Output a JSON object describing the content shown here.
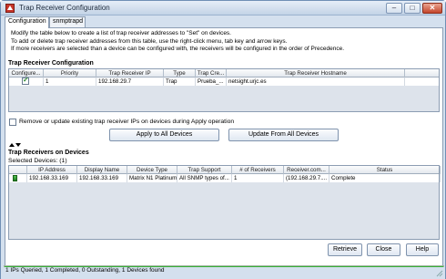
{
  "window": {
    "title": "Trap Receiver Configuration",
    "minimize": "–",
    "maximize": "□",
    "close": "✕"
  },
  "tabs": [
    {
      "label": "Configuration",
      "active": true
    },
    {
      "label": "snmptrapd",
      "active": false
    }
  ],
  "info_lines": [
    "Modify the table below to create a list of trap receiver addresses to \"Set\" on devices.",
    "To add or delete trap receiver addresses from this table, use the right-click menu, tab key and arrow keys.",
    "If more receivers are selected than a device can be configured with, the receivers will be configured in the order of Precedence."
  ],
  "config_section": {
    "title": "Trap Receiver Configuration",
    "columns": [
      "Configure...",
      "Priority",
      "Trap Receiver IP",
      "Type",
      "Trap Cre...",
      "Trap Receiver Hostname"
    ],
    "rows": [
      {
        "configure": true,
        "priority": "1",
        "ip": "192.168.29.7",
        "type": "Trap",
        "cred": "Prueba_...",
        "hostname": "netsight.urjc.es"
      }
    ]
  },
  "remove_option": {
    "label": "Remove or update existing trap receiver IPs on devices during Apply operation",
    "checked": false
  },
  "buttons": {
    "apply_all": "Apply to All Devices",
    "update_from_all": "Update From All Devices",
    "retrieve": "Retrieve",
    "close": "Close",
    "help": "Help"
  },
  "devices_section": {
    "title": "Trap Receivers on Devices",
    "selected": "Selected Devices: (1)",
    "columns": [
      "",
      "IP Address",
      "Display Name",
      "Device Type",
      "Trap Support",
      "# of Receivers",
      "Receiver.com...",
      "Status"
    ],
    "rows": [
      {
        "ip": "192.168.33.169",
        "name": "192.168.33.169",
        "type": "Matrix N1 Platinum",
        "support": "All SNMP types of...",
        "receivers": "1",
        "receiver_com": "(192.168.29.7....",
        "status": "Complete"
      }
    ]
  },
  "status": {
    "text": "1 IPs Queried, 1 Completed, 0 Outstanding, 1 Devices found",
    "progress": 1.0
  },
  "colors": {
    "progress_fill": "#38b038",
    "check": "#2d8a2d"
  }
}
